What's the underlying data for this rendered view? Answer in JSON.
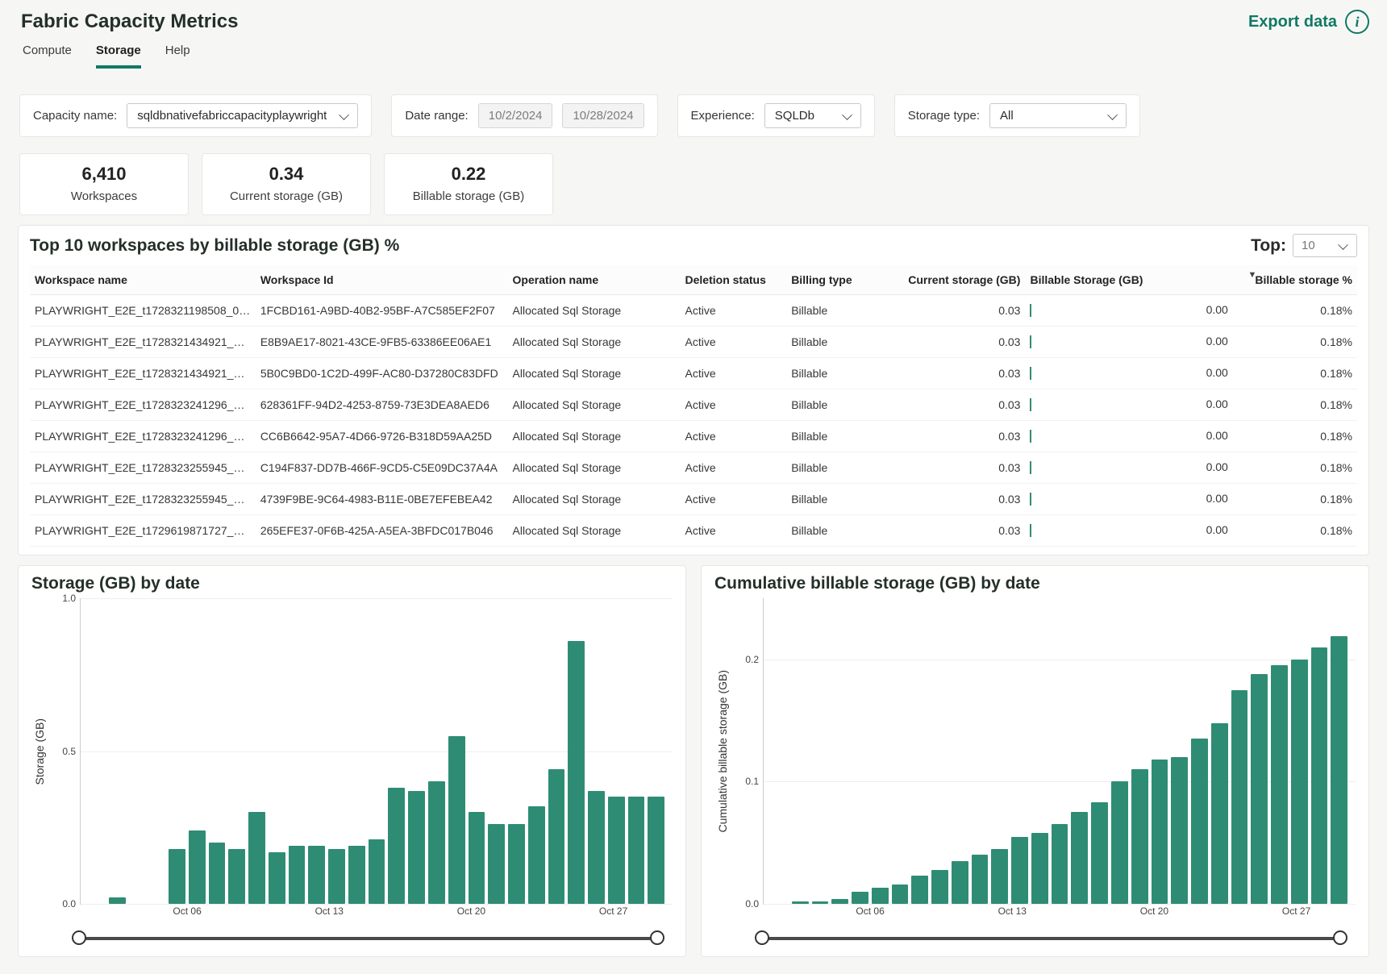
{
  "header": {
    "title": "Fabric Capacity Metrics",
    "export_label": "Export data"
  },
  "tabs": [
    "Compute",
    "Storage",
    "Help"
  ],
  "active_tab": "Storage",
  "filters": {
    "capacity_label": "Capacity name:",
    "capacity_value": "sqldbnativefabriccapacityplaywright",
    "date_label": "Date range:",
    "date_start": "10/2/2024",
    "date_end": "10/28/2024",
    "experience_label": "Experience:",
    "experience_value": "SQLDb",
    "storage_type_label": "Storage type:",
    "storage_type_value": "All"
  },
  "cards": [
    {
      "value": "6,410",
      "label": "Workspaces"
    },
    {
      "value": "0.34",
      "label": "Current storage (GB)"
    },
    {
      "value": "0.22",
      "label": "Billable storage (GB)"
    }
  ],
  "table": {
    "title": "Top 10 workspaces by billable storage (GB) %",
    "top_label": "Top:",
    "top_value": "10",
    "columns": [
      "Workspace name",
      "Workspace Id",
      "Operation name",
      "Deletion status",
      "Billing type",
      "Current storage (GB)",
      "Billable Storage (GB)",
      "Billable storage %"
    ],
    "rows": [
      {
        "name": "PLAYWRIGHT_E2E_t1728321198508_0ea...",
        "id": "1FCBD161-A9BD-40B2-95BF-A7C585EF2F07",
        "op": "Allocated Sql Storage",
        "del": "Active",
        "bill": "Billable",
        "cur": "0.03",
        "bs": "0.00",
        "pct": "0.18%"
      },
      {
        "name": "PLAYWRIGHT_E2E_t1728321434921_0c8...",
        "id": "E8B9AE17-8021-43CE-9FB5-63386EE06AE1",
        "op": "Allocated Sql Storage",
        "del": "Active",
        "bill": "Billable",
        "cur": "0.03",
        "bs": "0.00",
        "pct": "0.18%"
      },
      {
        "name": "PLAYWRIGHT_E2E_t1728321434921_0c8...",
        "id": "5B0C9BD0-1C2D-499F-AC80-D37280C83DFD",
        "op": "Allocated Sql Storage",
        "del": "Active",
        "bill": "Billable",
        "cur": "0.03",
        "bs": "0.00",
        "pct": "0.18%"
      },
      {
        "name": "PLAYWRIGHT_E2E_t1728323241296_3a...",
        "id": "628361FF-94D2-4253-8759-73E3DEA8AED6",
        "op": "Allocated Sql Storage",
        "del": "Active",
        "bill": "Billable",
        "cur": "0.03",
        "bs": "0.00",
        "pct": "0.18%"
      },
      {
        "name": "PLAYWRIGHT_E2E_t1728323241296_3a...",
        "id": "CC6B6642-95A7-4D66-9726-B318D59AA25D",
        "op": "Allocated Sql Storage",
        "del": "Active",
        "bill": "Billable",
        "cur": "0.03",
        "bs": "0.00",
        "pct": "0.18%"
      },
      {
        "name": "PLAYWRIGHT_E2E_t1728323255945_0e...",
        "id": "C194F837-DD7B-466F-9CD5-C5E09DC37A4A",
        "op": "Allocated Sql Storage",
        "del": "Active",
        "bill": "Billable",
        "cur": "0.03",
        "bs": "0.00",
        "pct": "0.18%"
      },
      {
        "name": "PLAYWRIGHT_E2E_t1728323255945_0e...",
        "id": "4739F9BE-9C64-4983-B11E-0BE7EFEBEA42",
        "op": "Allocated Sql Storage",
        "del": "Active",
        "bill": "Billable",
        "cur": "0.03",
        "bs": "0.00",
        "pct": "0.18%"
      },
      {
        "name": "PLAYWRIGHT_E2E_t1729619871727_28...",
        "id": "265EFE37-0F6B-425A-A5EA-3BFDC017B046",
        "op": "Allocated Sql Storage",
        "del": "Active",
        "bill": "Billable",
        "cur": "0.03",
        "bs": "0.00",
        "pct": "0.18%"
      }
    ]
  },
  "chart_data": [
    {
      "type": "bar",
      "title": "Storage (GB) by date",
      "ylabel": "Storage (GB)",
      "ylim": [
        0,
        1.0
      ],
      "yticks": [
        0.0,
        0.5,
        1.0
      ],
      "xticks": [
        "Oct 06",
        "Oct 13",
        "Oct 20",
        "Oct 27"
      ],
      "categories": [
        "Oct 02",
        "Oct 03",
        "Oct 04",
        "Oct 05",
        "Oct 06",
        "Oct 07",
        "Oct 08",
        "Oct 09",
        "Oct 10",
        "Oct 11",
        "Oct 12",
        "Oct 13",
        "Oct 14",
        "Oct 15",
        "Oct 16",
        "Oct 17",
        "Oct 18",
        "Oct 19",
        "Oct 20",
        "Oct 21",
        "Oct 22",
        "Oct 23",
        "Oct 24",
        "Oct 25",
        "Oct 26",
        "Oct 27",
        "Oct 28"
      ],
      "values": [
        0.0,
        0.02,
        0.0,
        0.0,
        0.18,
        0.24,
        0.2,
        0.18,
        0.3,
        0.17,
        0.19,
        0.19,
        0.18,
        0.19,
        0.21,
        0.38,
        0.37,
        0.4,
        0.55,
        0.3,
        0.26,
        0.26,
        0.32,
        0.44,
        0.86,
        0.37,
        0.35,
        0.35,
        0.35
      ]
    },
    {
      "type": "bar",
      "title": "Cumulative billable storage (GB) by date",
      "ylabel": "Cumulative billable storage (GB)",
      "ylim": [
        0,
        0.25
      ],
      "yticks": [
        0.0,
        0.1,
        0.2
      ],
      "xticks": [
        "Oct 06",
        "Oct 13",
        "Oct 20",
        "Oct 27"
      ],
      "categories": [
        "Oct 02",
        "Oct 03",
        "Oct 04",
        "Oct 05",
        "Oct 06",
        "Oct 07",
        "Oct 08",
        "Oct 09",
        "Oct 10",
        "Oct 11",
        "Oct 12",
        "Oct 13",
        "Oct 14",
        "Oct 15",
        "Oct 16",
        "Oct 17",
        "Oct 18",
        "Oct 19",
        "Oct 20",
        "Oct 21",
        "Oct 22",
        "Oct 23",
        "Oct 24",
        "Oct 25",
        "Oct 26",
        "Oct 27",
        "Oct 28"
      ],
      "values": [
        0.0,
        0.002,
        0.002,
        0.004,
        0.01,
        0.013,
        0.016,
        0.023,
        0.028,
        0.035,
        0.04,
        0.045,
        0.055,
        0.058,
        0.065,
        0.075,
        0.083,
        0.1,
        0.11,
        0.118,
        0.12,
        0.135,
        0.148,
        0.175,
        0.188,
        0.195,
        0.2,
        0.21,
        0.219
      ]
    }
  ]
}
